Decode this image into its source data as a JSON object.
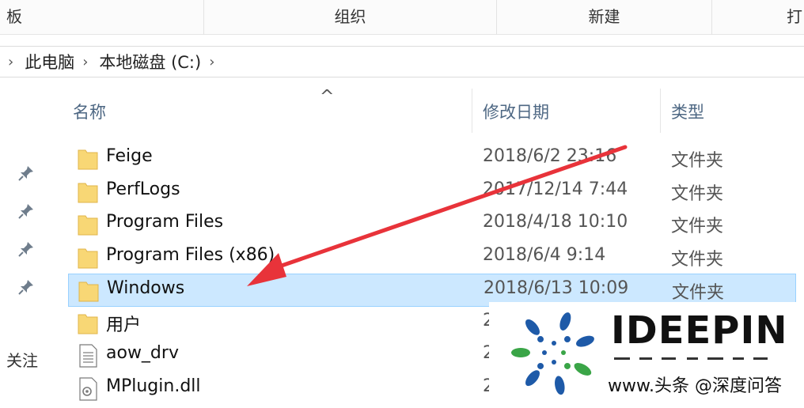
{
  "ribbon": {
    "groups": [
      "板",
      "组织",
      "新建",
      "打"
    ]
  },
  "address": {
    "crumbs": [
      "此电脑",
      "本地磁盘 (C:)"
    ]
  },
  "columns": {
    "name": "名称",
    "date": "修改日期",
    "type": "类型"
  },
  "files": [
    {
      "name": "Feige",
      "date": "2018/6/2 23:16",
      "type": "文件夹",
      "icon": "folder-icon"
    },
    {
      "name": "PerfLogs",
      "date": "2017/12/14 7:44",
      "type": "文件夹",
      "icon": "folder-icon"
    },
    {
      "name": "Program Files",
      "date": "2018/4/18 10:10",
      "type": "文件夹",
      "icon": "folder-icon"
    },
    {
      "name": "Program Files (x86)",
      "date": "2018/6/4 9:14",
      "type": "文件夹",
      "icon": "folder-icon"
    },
    {
      "name": "Windows",
      "date": "2018/6/13 10:09",
      "type": "文件夹",
      "icon": "folder-icon",
      "selected": true
    },
    {
      "name": "用户",
      "date": "2",
      "type": "",
      "icon": "folder-icon"
    },
    {
      "name": "aow_drv",
      "date": "2",
      "type": "",
      "icon": "text-file-icon"
    },
    {
      "name": "MPlugin.dll",
      "date": "2",
      "type": "",
      "icon": "dll-file-icon"
    }
  ],
  "left_pane": {
    "pin_icon": "pin-icon",
    "partial_label": "关注"
  },
  "watermark": {
    "brand": "IDEEPIN",
    "credit": "头条 @深度问答",
    "credit_prefix": "www."
  },
  "colors": {
    "selection_bg": "#cce8ff",
    "selection_border": "#99d1ff",
    "arrow": "#e8333a",
    "folder": "#f8d775",
    "header_text": "#4d6783",
    "logo_blue": "#1e5aa8",
    "logo_green": "#3aa547"
  }
}
